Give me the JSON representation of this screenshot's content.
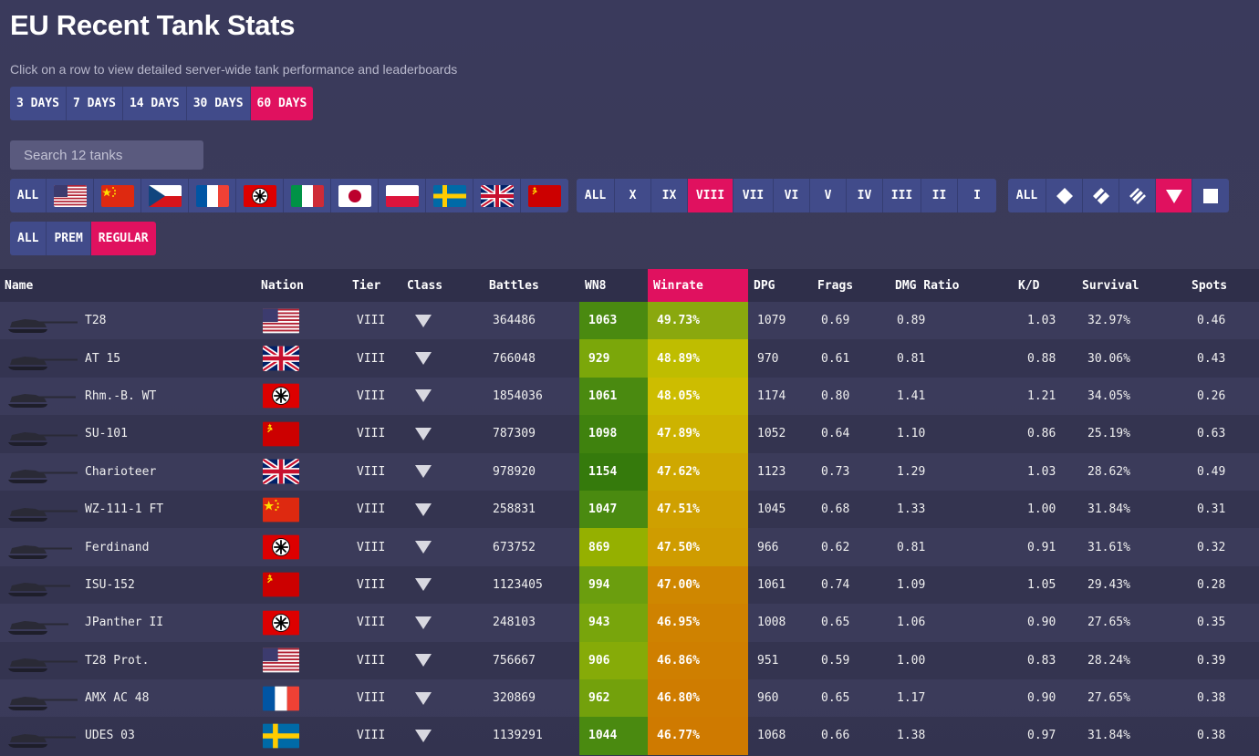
{
  "title": "EU Recent Tank Stats",
  "subtitle": "Click on a row to view detailed server-wide tank performance and leaderboards",
  "days": [
    {
      "label": "3 DAYS",
      "active": false
    },
    {
      "label": "7 DAYS",
      "active": false
    },
    {
      "label": "14 DAYS",
      "active": false
    },
    {
      "label": "30 DAYS",
      "active": false
    },
    {
      "label": "60 DAYS",
      "active": true
    }
  ],
  "search": {
    "placeholder": "Search 12 tanks"
  },
  "nation_filter": {
    "all_label": "ALL",
    "nations": [
      "usa",
      "china",
      "czech",
      "france",
      "germany",
      "italy",
      "japan",
      "poland",
      "sweden",
      "uk",
      "ussr"
    ]
  },
  "tier_filter": {
    "items": [
      {
        "label": "ALL",
        "active": false
      },
      {
        "label": "X",
        "active": false
      },
      {
        "label": "IX",
        "active": false
      },
      {
        "label": "VIII",
        "active": true
      },
      {
        "label": "VII",
        "active": false
      },
      {
        "label": "VI",
        "active": false
      },
      {
        "label": "V",
        "active": false
      },
      {
        "label": "IV",
        "active": false
      },
      {
        "label": "III",
        "active": false
      },
      {
        "label": "II",
        "active": false
      },
      {
        "label": "I",
        "active": false
      }
    ]
  },
  "class_filter": {
    "all_label": "ALL",
    "items": [
      {
        "icon": "light-tank-icon",
        "active": false
      },
      {
        "icon": "medium-tank-icon",
        "active": false
      },
      {
        "icon": "heavy-tank-icon",
        "active": false
      },
      {
        "icon": "tank-destroyer-icon",
        "active": true
      },
      {
        "icon": "spg-icon",
        "active": false
      }
    ]
  },
  "type_filter": {
    "items": [
      {
        "label": "ALL",
        "active": false
      },
      {
        "label": "PREM",
        "active": false
      },
      {
        "label": "REGULAR",
        "active": true
      }
    ]
  },
  "table": {
    "headers": [
      "Name",
      "Nation",
      "Tier",
      "Class",
      "Battles",
      "WN8",
      "Winrate",
      "DPG",
      "Frags",
      "DMG Ratio",
      "K/D",
      "Survival",
      "Spots"
    ],
    "active_header": "Winrate",
    "rows": [
      {
        "name": "T28",
        "nation": "usa",
        "tier": "VIII",
        "battles": "364486",
        "wn8": "1063",
        "wn8_color": "#4a8a10",
        "winrate": "49.73%",
        "wr_color": "#8aa80e",
        "dpg": "1079",
        "frags": "0.69",
        "dmg_ratio": "0.89",
        "kd": "1.03",
        "survival": "32.97%",
        "spots": "0.46"
      },
      {
        "name": "AT 15",
        "nation": "uk",
        "tier": "VIII",
        "battles": "766048",
        "wn8": "929",
        "wn8_color": "#7ba70a",
        "winrate": "48.89%",
        "wr_color": "#bfbd00",
        "dpg": "970",
        "frags": "0.61",
        "dmg_ratio": "0.81",
        "kd": "0.88",
        "survival": "30.06%",
        "spots": "0.43"
      },
      {
        "name": "Rhm.-B. WT",
        "nation": "germany",
        "tier": "VIII",
        "battles": "1854036",
        "wn8": "1061",
        "wn8_color": "#4a8a10",
        "winrate": "48.05%",
        "wr_color": "#cdbd00",
        "dpg": "1174",
        "frags": "0.80",
        "dmg_ratio": "1.41",
        "kd": "1.21",
        "survival": "34.05%",
        "spots": "0.26"
      },
      {
        "name": "SU-101",
        "nation": "ussr",
        "tier": "VIII",
        "battles": "787309",
        "wn8": "1098",
        "wn8_color": "#3f820e",
        "winrate": "47.89%",
        "wr_color": "#cdb300",
        "dpg": "1052",
        "frags": "0.64",
        "dmg_ratio": "1.10",
        "kd": "0.86",
        "survival": "25.19%",
        "spots": "0.63"
      },
      {
        "name": "Charioteer",
        "nation": "uk",
        "tier": "VIII",
        "battles": "978920",
        "wn8": "1154",
        "wn8_color": "#357a0c",
        "winrate": "47.62%",
        "wr_color": "#cfa800",
        "dpg": "1123",
        "frags": "0.73",
        "dmg_ratio": "1.29",
        "kd": "1.03",
        "survival": "28.62%",
        "spots": "0.49"
      },
      {
        "name": "WZ-111-1 FT",
        "nation": "china",
        "tier": "VIII",
        "battles": "258831",
        "wn8": "1047",
        "wn8_color": "#4a8a10",
        "winrate": "47.51%",
        "wr_color": "#cfa000",
        "dpg": "1045",
        "frags": "0.68",
        "dmg_ratio": "1.33",
        "kd": "1.00",
        "survival": "31.84%",
        "spots": "0.31"
      },
      {
        "name": "Ferdinand",
        "nation": "germany",
        "tier": "VIII",
        "battles": "673752",
        "wn8": "869",
        "wn8_color": "#95b000",
        "winrate": "47.50%",
        "wr_color": "#cf9c00",
        "dpg": "966",
        "frags": "0.62",
        "dmg_ratio": "0.81",
        "kd": "0.91",
        "survival": "31.61%",
        "spots": "0.32"
      },
      {
        "name": "ISU-152",
        "nation": "ussr",
        "tier": "VIII",
        "battles": "1123405",
        "wn8": "994",
        "wn8_color": "#6b9e0e",
        "winrate": "47.00%",
        "wr_color": "#cf8700",
        "dpg": "1061",
        "frags": "0.74",
        "dmg_ratio": "1.09",
        "kd": "1.05",
        "survival": "29.43%",
        "spots": "0.28"
      },
      {
        "name": "JPanther II",
        "nation": "germany",
        "tier": "VIII",
        "battles": "248103",
        "wn8": "943",
        "wn8_color": "#78a50c",
        "winrate": "46.95%",
        "wr_color": "#cf8200",
        "dpg": "1008",
        "frags": "0.65",
        "dmg_ratio": "1.06",
        "kd": "0.90",
        "survival": "27.65%",
        "spots": "0.35"
      },
      {
        "name": "T28 Prot.",
        "nation": "usa",
        "tier": "VIII",
        "battles": "756667",
        "wn8": "906",
        "wn8_color": "#86ab08",
        "winrate": "46.86%",
        "wr_color": "#cf7f00",
        "dpg": "951",
        "frags": "0.59",
        "dmg_ratio": "1.00",
        "kd": "0.83",
        "survival": "28.24%",
        "spots": "0.39"
      },
      {
        "name": "AMX AC 48",
        "nation": "france",
        "tier": "VIII",
        "battles": "320869",
        "wn8": "962",
        "wn8_color": "#73a10c",
        "winrate": "46.80%",
        "wr_color": "#cf7c00",
        "dpg": "960",
        "frags": "0.65",
        "dmg_ratio": "1.17",
        "kd": "0.90",
        "survival": "27.65%",
        "spots": "0.38"
      },
      {
        "name": "UDES 03",
        "nation": "sweden",
        "tier": "VIII",
        "battles": "1139291",
        "wn8": "1044",
        "wn8_color": "#4a8a10",
        "winrate": "46.77%",
        "wr_color": "#cf7a00",
        "dpg": "1068",
        "frags": "0.66",
        "dmg_ratio": "1.38",
        "kd": "0.97",
        "survival": "31.84%",
        "spots": "0.38"
      }
    ]
  }
}
